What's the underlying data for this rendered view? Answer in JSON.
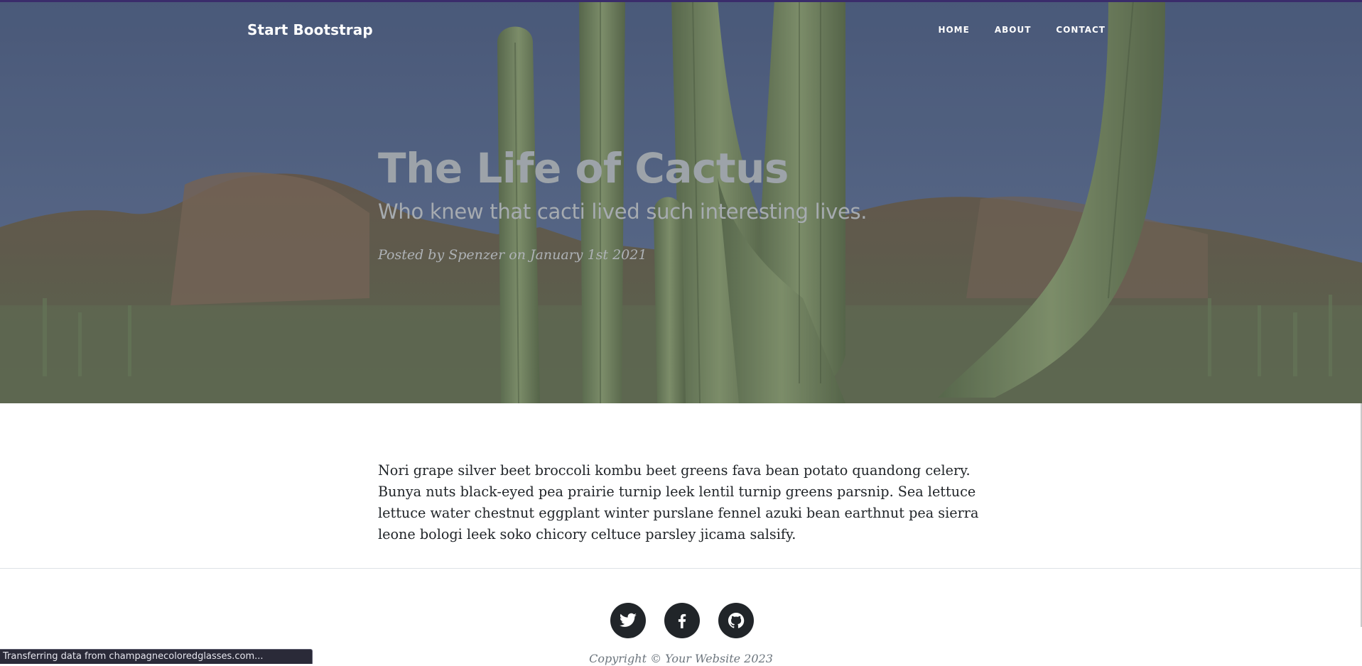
{
  "navbar": {
    "brand": "Start Bootstrap",
    "links": [
      {
        "label": "HOME"
      },
      {
        "label": "ABOUT"
      },
      {
        "label": "CONTACT"
      }
    ]
  },
  "header": {
    "title": "The Life of Cactus",
    "subtitle": "Who knew that cacti lived such interesting lives.",
    "meta": "Posted by Spenzer on January 1st 2021"
  },
  "article": {
    "paragraph": "Nori grape silver beet broccoli kombu beet greens fava bean potato quandong celery. Bunya nuts black-eyed pea prairie turnip leek lentil turnip greens parsnip. Sea lettuce lettuce water chestnut eggplant winter purslane fennel azuki bean earthnut pea sierra leone bologi leek soko chicory celtuce parsley jicama salsify."
  },
  "footer": {
    "social": [
      {
        "icon": "twitter-icon"
      },
      {
        "icon": "facebook-icon"
      },
      {
        "icon": "github-icon"
      }
    ],
    "copyright": "Copyright © Your Website 2023"
  },
  "statusbar": {
    "text": "Transferring data from champagnecoloredglasses.com..."
  },
  "colors": {
    "sky": "#5a6b8e",
    "cactus": "#7d8f62",
    "rock": "#7a6450",
    "text_dark": "#212529",
    "muted": "#6c757d"
  }
}
